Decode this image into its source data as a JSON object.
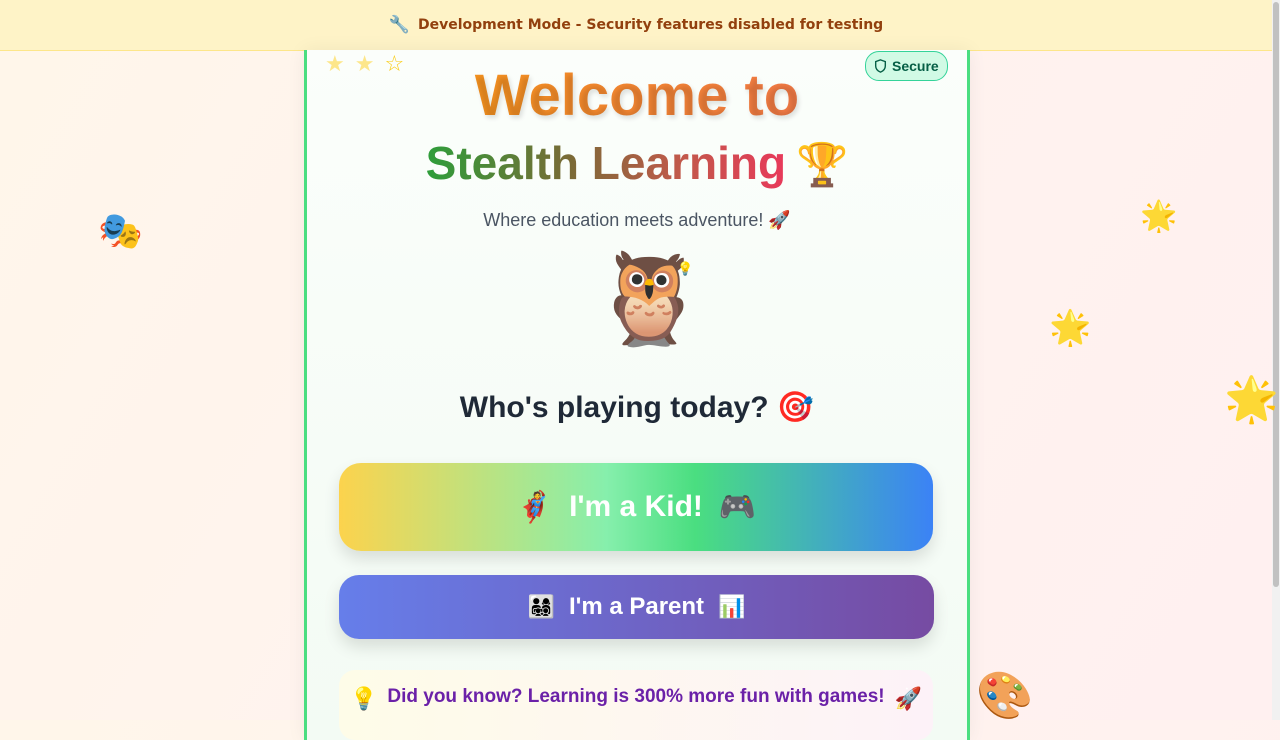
{
  "banner": {
    "icon": "wrench-icon",
    "text": "Development Mode - Security features disabled for testing",
    "emoji": "🔧"
  },
  "card": {
    "secure_badge": "Secure",
    "title_line1": "Welcome to",
    "title_line2": "Stealth Learning",
    "title_emoji": "🏆",
    "tagline": "Where education meets adventure! 🚀",
    "mascot": "🦉",
    "mascot_bulb": "💡",
    "question": "Who's playing today? 🎯",
    "kid_button": {
      "left_emoji": "🦸",
      "label": "I'm a Kid!",
      "right_emoji": "🎮"
    },
    "parent_button": {
      "left_emoji": "👨‍👩‍👧‍👦",
      "label": "I'm a Parent",
      "right_emoji": "📊"
    },
    "fact": {
      "left_emoji": "💡",
      "text": "Did you know? Learning is 300% more fun with games!",
      "right_emoji": "🚀"
    }
  },
  "floating_decorations": {
    "masks": "🎭",
    "star_a": "🌟",
    "star_b": "🌟",
    "star_c": "🌟",
    "palette": "🎨"
  },
  "colors": {
    "banner_bg": "#fef3c7",
    "banner_text": "#92400e",
    "card_border": "#4ade80",
    "secure_bg": "#d1fae5",
    "parent_gradient_start": "#667eea",
    "parent_gradient_end": "#764ba2",
    "fact_text": "#6b21a8"
  }
}
